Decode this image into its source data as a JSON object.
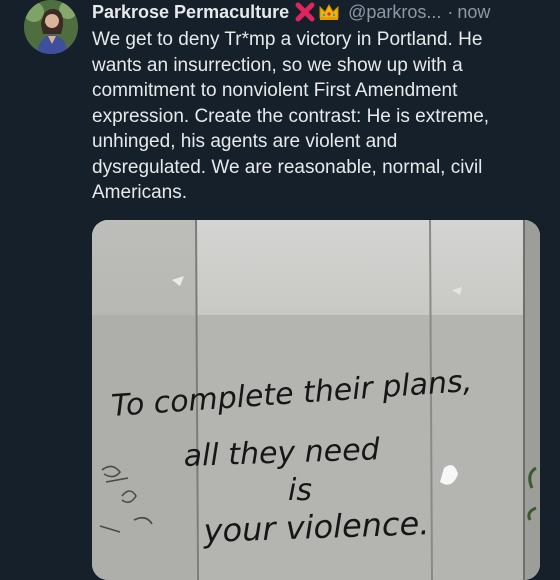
{
  "tweet": {
    "display_name": "Parkrose Permaculture",
    "badges": [
      "cross-mark-icon",
      "crown-icon"
    ],
    "handle": "@parkros...",
    "separator": "·",
    "timestamp": "now",
    "text": "We get to deny Tr*mp a victory in Portland. He\nwants an insurrection, so we show up with a\ncommitment to nonviolent First Amendment\nexpression. Create the contrast: He is extreme,\nunhinged, his agents are violent and\ndysregulated. We are reasonable, normal, civil\nAmericans."
  },
  "media": {
    "graffiti_lines": [
      "To complete their plans,",
      "all they need",
      "is",
      "your violence."
    ]
  },
  "colors": {
    "background": "#15202b",
    "text": "#e7e9ea",
    "muted": "#8b98a5",
    "badge_red": "#e0245e",
    "wall": "#bfbfbd"
  }
}
